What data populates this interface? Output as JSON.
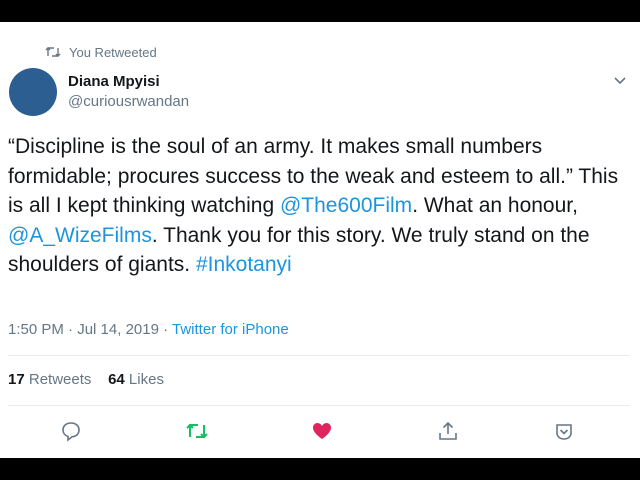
{
  "retweet": {
    "label": "You Retweeted",
    "icon": "retweet-icon"
  },
  "author": {
    "name": "Diana Mpyisi",
    "handle": "@curiousrwandan",
    "avatar_color": "#2c5e92"
  },
  "tweet": {
    "text_1": "“Discipline is the soul of an army. It makes small numbers formidable; procures success to the weak and esteem to all.” This is all I kept thinking watching ",
    "mention_1": "@The600Film",
    "text_2": ". What an honour, ",
    "mention_2": "@A_WizeFilms",
    "text_3": ". Thank you for this story. We truly stand on the shoulders of giants. ",
    "hashtag": "#Inkotanyi"
  },
  "meta": {
    "time": "1:50 PM",
    "sep1": " · ",
    "date": "Jul 14, 2019",
    "sep2": " · ",
    "source": "Twitter for iPhone"
  },
  "stats": {
    "retweets_count": "17",
    "retweets_label": "Retweets",
    "likes_count": "64",
    "likes_label": "Likes"
  },
  "actions": {
    "reply_icon": "reply-icon",
    "retweet_icon": "retweet-icon",
    "like_icon": "heart-icon",
    "share_icon": "share-icon",
    "more_icon": "chevron-down-icon"
  },
  "colors": {
    "link": "#1b95e0",
    "muted": "#657786",
    "retweet_active": "#17bf63",
    "like_active": "#e0245e"
  }
}
